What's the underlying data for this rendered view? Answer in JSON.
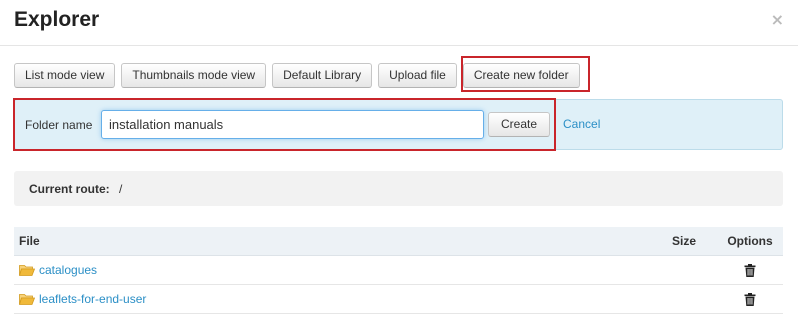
{
  "window": {
    "title": "Explorer",
    "close_glyph": "×"
  },
  "toolbar": {
    "buttons": [
      {
        "label": "List mode view"
      },
      {
        "label": "Thumbnails mode view"
      },
      {
        "label": "Default Library"
      },
      {
        "label": "Upload file"
      },
      {
        "label": "Create new folder"
      }
    ]
  },
  "new_folder": {
    "label": "Folder name",
    "value": "installation manuals",
    "create_label": "Create",
    "cancel_label": "Cancel"
  },
  "route": {
    "label": "Current route:",
    "value": "/"
  },
  "table": {
    "headers": {
      "file": "File",
      "size": "Size",
      "options": "Options"
    },
    "rows": [
      {
        "name": "catalogues",
        "size": "",
        "icon": "folder-open-icon",
        "option_icon": "trash-icon"
      },
      {
        "name": "leaflets-for-end-user",
        "size": "",
        "icon": "folder-open-icon",
        "option_icon": "trash-icon"
      }
    ]
  },
  "colors": {
    "accent_link": "#2b8fc6",
    "highlight_box": "#c9252b",
    "info_panel": "#dff0f8",
    "folder_icon": "#f0b93a"
  }
}
